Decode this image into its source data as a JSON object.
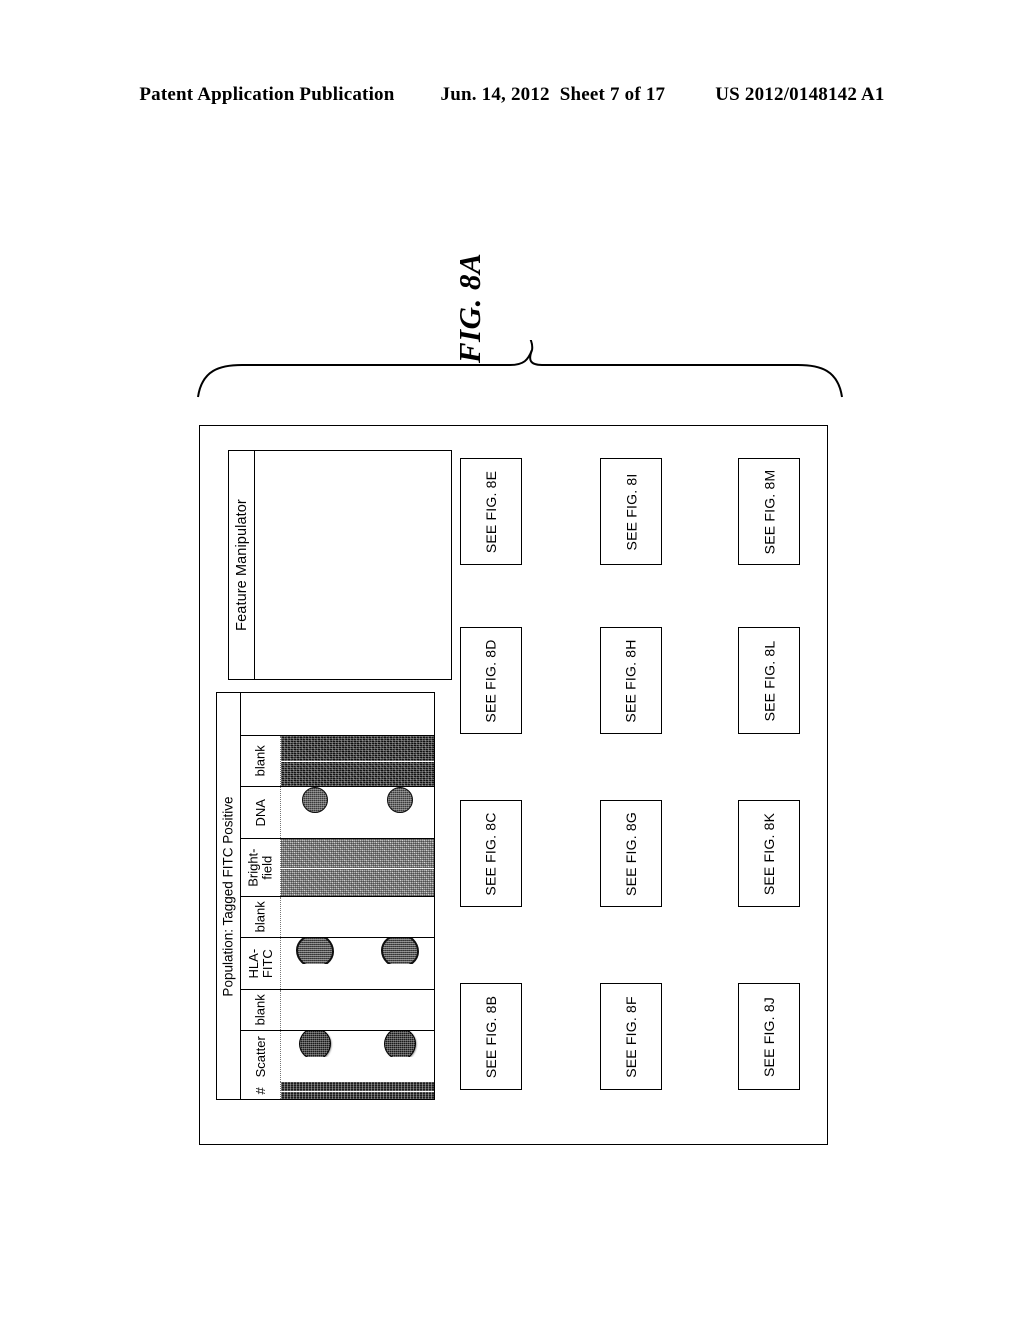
{
  "header": {
    "publication": "Patent Application Publication",
    "date": "Jun. 14, 2012",
    "sheet": "Sheet 7 of 17",
    "number": "US 2012/0148142 A1"
  },
  "figure": {
    "label": "FIG. 8A"
  },
  "feature_panel": {
    "title": "Feature Manipulator"
  },
  "data_table": {
    "title": "Population: Tagged FITC Positive",
    "columns": [
      {
        "label": "#",
        "fill": "numstrip"
      },
      {
        "label": "Scatter",
        "fill": "white",
        "blob": "scatter"
      },
      {
        "label": "blank",
        "fill": "white"
      },
      {
        "label": "HLA-\nFITC",
        "fill": "white",
        "blob": "fitc"
      },
      {
        "label": "blank",
        "fill": "white"
      },
      {
        "label": "Bright-\nfield",
        "fill": "gray"
      },
      {
        "label": "DNA",
        "fill": "white",
        "blob": "dna"
      },
      {
        "label": "blank",
        "fill": "dark"
      }
    ],
    "row_count": 2
  },
  "see_fig_boxes": {
    "row1": [
      "SEE FIG. 8B",
      "SEE FIG. 8C",
      "SEE FIG. 8D",
      "SEE FIG. 8E"
    ],
    "row2": [
      "SEE FIG. 8F",
      "SEE FIG. 8G",
      "SEE FIG. 8H",
      "SEE FIG. 8I"
    ],
    "row3": [
      "SEE FIG. 8J",
      "SEE FIG. 8K",
      "SEE FIG. 8L",
      "SEE FIG. 8M"
    ]
  },
  "colors": {
    "ink": "#000000",
    "paper": "#ffffff"
  }
}
